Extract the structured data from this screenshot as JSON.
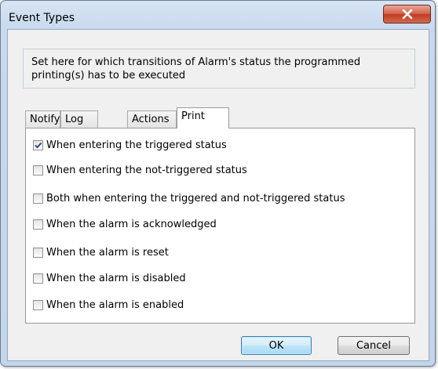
{
  "window": {
    "title": "Event Types",
    "close_label": "X"
  },
  "info_text": "Set here for which transitions of Alarm's status the programmed printing(s) has to be executed",
  "tabs": [
    {
      "label": "Notify",
      "active": false
    },
    {
      "label": "Log",
      "active": false
    },
    {
      "label": "Actions",
      "active": false
    },
    {
      "label": "Print",
      "active": true
    }
  ],
  "options": [
    {
      "label": "When entering the triggered status",
      "checked": true
    },
    {
      "label": "When entering the not-triggered status",
      "checked": false
    },
    {
      "label": "Both when entering the triggered and not-triggered status",
      "checked": false
    },
    {
      "label": "When the alarm is acknowledged",
      "checked": false
    },
    {
      "label": "When the alarm is reset",
      "checked": false
    },
    {
      "label": "When the alarm is disabled",
      "checked": false
    },
    {
      "label": "When the alarm is enabled",
      "checked": false
    }
  ],
  "buttons": {
    "ok": "OK",
    "cancel": "Cancel"
  }
}
